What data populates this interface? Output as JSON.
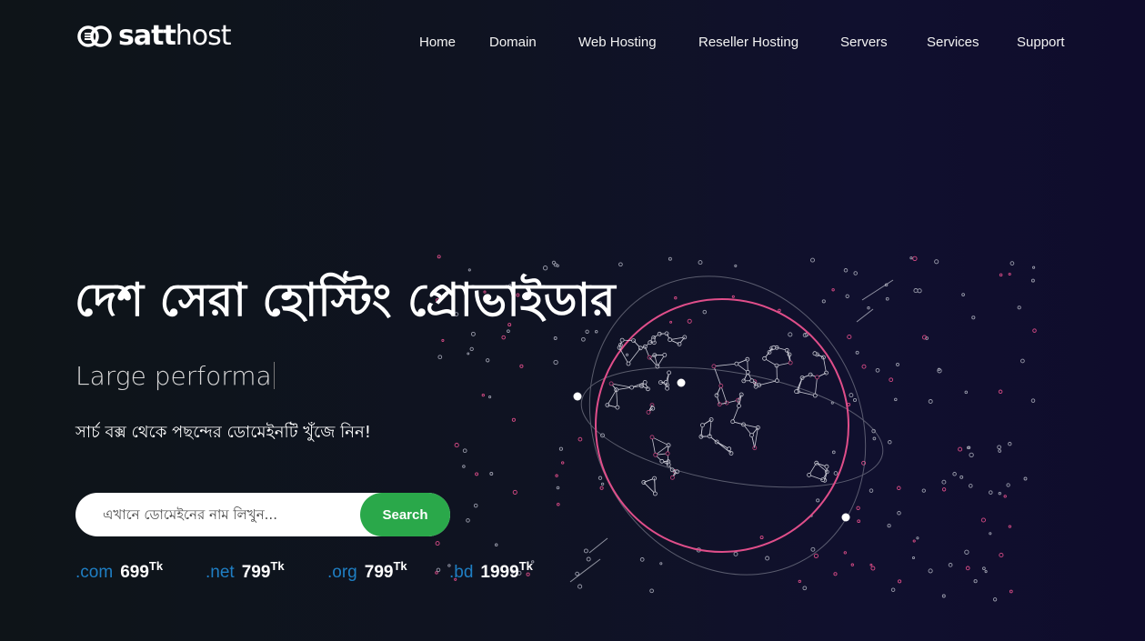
{
  "brand": {
    "name_bold": "satt",
    "name_regular": "host",
    "logo_icon": "linked-rings-logo-icon"
  },
  "nav": {
    "items": [
      {
        "label": "Home"
      },
      {
        "label": "Domain"
      },
      {
        "label": "Web Hosting"
      },
      {
        "label": "Reseller Hosting"
      },
      {
        "label": "Servers"
      },
      {
        "label": "Services"
      },
      {
        "label": "Support"
      }
    ]
  },
  "hero": {
    "title": "দেশ সেরা হোস্টিং প্রোভাইডার",
    "typed_text": "Large performa",
    "subtitle": "সার্চ বক্স থেকে পছন্দের ডোমেইনটি খুঁজে নিন!",
    "illustration": "network-globe-illustration"
  },
  "search": {
    "placeholder": "এখানে ডোমেইনের নাম লিখুন...",
    "button_label": "Search"
  },
  "prices": [
    {
      "ext": ".com",
      "amount": "699",
      "currency": "Tk"
    },
    {
      "ext": ".net",
      "amount": "799",
      "currency": "Tk"
    },
    {
      "ext": ".org",
      "amount": "799",
      "currency": "Tk"
    },
    {
      "ext": ".bd",
      "amount": "1999",
      "currency": "Tk"
    }
  ],
  "colors": {
    "accent_green": "#2aa84a",
    "extension_blue": "#1f7fc4",
    "globe_pink": "#e04e8a",
    "background_dark": "#0f1320"
  }
}
